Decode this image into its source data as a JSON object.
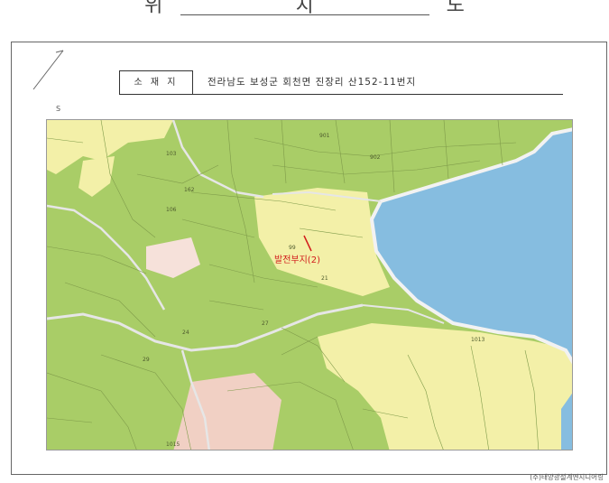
{
  "title": "위    치    도",
  "location": {
    "label": "소 재 지",
    "value": "전라남도 보성군 회천면 진장리 산152-11번지"
  },
  "scale_note": "S",
  "site_label": "발전부지(2)",
  "footer": "(주)태양광설계엔지니어링",
  "colors": {
    "forest": "#a9cd67",
    "farmland": "#f3f0a8",
    "sea": "#86bde0",
    "parcel_lines": "#7f9b4a",
    "roads": "#e6e6e6",
    "site_marker": "#d21c1c"
  },
  "parcel_labels": [
    {
      "text": "103"
    },
    {
      "text": "162"
    },
    {
      "text": "106"
    },
    {
      "text": "901"
    },
    {
      "text": "902"
    },
    {
      "text": "99"
    },
    {
      "text": "21"
    },
    {
      "text": "1013"
    },
    {
      "text": "24"
    },
    {
      "text": "29"
    },
    {
      "text": "27"
    },
    {
      "text": "1015"
    }
  ]
}
